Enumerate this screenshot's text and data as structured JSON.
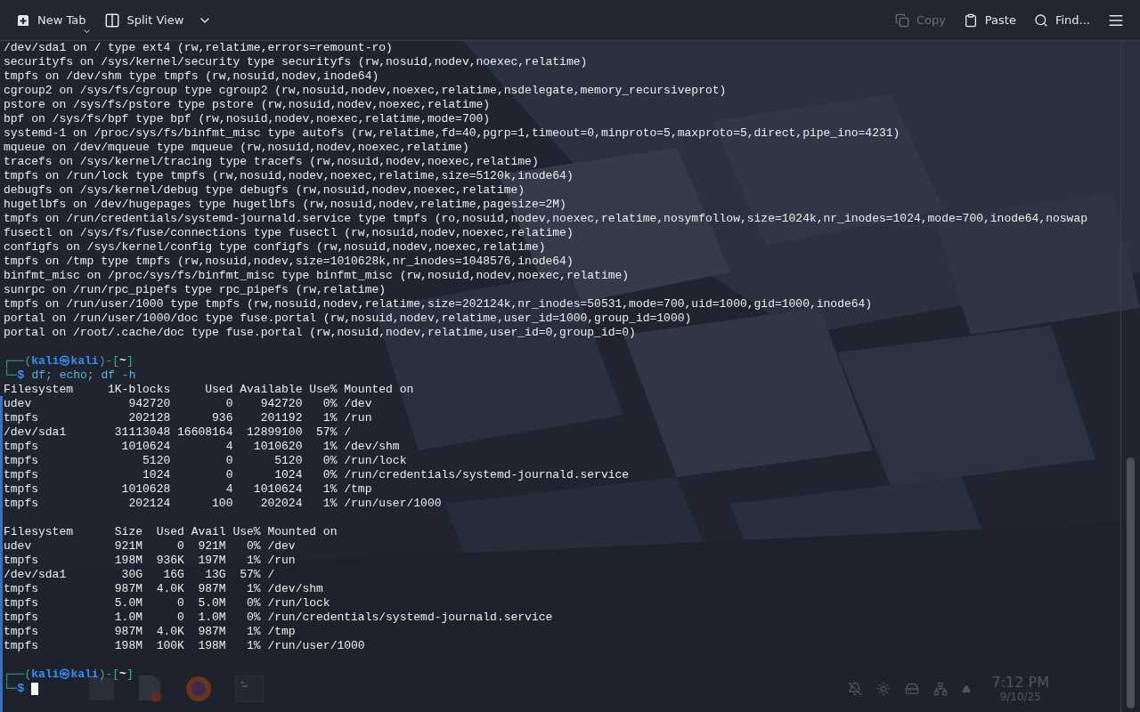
{
  "toolbar": {
    "left": [
      {
        "kind": "new_tab",
        "label": "New Tab",
        "disabled": false
      },
      {
        "kind": "split_view",
        "label": "Split View",
        "disabled": false
      }
    ],
    "right": [
      {
        "kind": "copy",
        "label": "Copy",
        "disabled": true
      },
      {
        "kind": "paste",
        "label": "Paste",
        "disabled": false
      },
      {
        "kind": "find",
        "label": "Find...",
        "disabled": false
      },
      {
        "kind": "menu",
        "disabled": false
      }
    ]
  },
  "terminal": {
    "lines": [
      {
        "kind": "output",
        "text": "/dev/sda1 on / type ext4 (rw,relatime,errors=remount-ro)"
      },
      {
        "kind": "output",
        "text": "securityfs on /sys/kernel/security type securityfs (rw,nosuid,nodev,noexec,relatime)"
      },
      {
        "kind": "output",
        "text": "tmpfs on /dev/shm type tmpfs (rw,nosuid,nodev,inode64)"
      },
      {
        "kind": "output",
        "text": "cgroup2 on /sys/fs/cgroup type cgroup2 (rw,nosuid,nodev,noexec,relatime,nsdelegate,memory_recursiveprot)"
      },
      {
        "kind": "output",
        "text": "pstore on /sys/fs/pstore type pstore (rw,nosuid,nodev,noexec,relatime)"
      },
      {
        "kind": "output",
        "text": "bpf on /sys/fs/bpf type bpf (rw,nosuid,nodev,noexec,relatime,mode=700)"
      },
      {
        "kind": "output",
        "text": "systemd-1 on /proc/sys/fs/binfmt_misc type autofs (rw,relatime,fd=40,pgrp=1,timeout=0,minproto=5,maxproto=5,direct,pipe_ino=4231)"
      },
      {
        "kind": "output",
        "text": "mqueue on /dev/mqueue type mqueue (rw,nosuid,nodev,noexec,relatime)"
      },
      {
        "kind": "output",
        "text": "tracefs on /sys/kernel/tracing type tracefs (rw,nosuid,nodev,noexec,relatime)"
      },
      {
        "kind": "output",
        "text": "tmpfs on /run/lock type tmpfs (rw,nosuid,nodev,noexec,relatime,size=5120k,inode64)"
      },
      {
        "kind": "output",
        "text": "debugfs on /sys/kernel/debug type debugfs (rw,nosuid,nodev,noexec,relatime)"
      },
      {
        "kind": "output",
        "text": "hugetlbfs on /dev/hugepages type hugetlbfs (rw,nosuid,nodev,relatime,pagesize=2M)"
      },
      {
        "kind": "output",
        "text": "tmpfs on /run/credentials/systemd-journald.service type tmpfs (ro,nosuid,nodev,noexec,relatime,nosymfollow,size=1024k,nr_inodes=1024,mode=700,inode64,noswap"
      },
      {
        "kind": "output",
        "text": "fusectl on /sys/fs/fuse/connections type fusectl (rw,nosuid,nodev,noexec,relatime)"
      },
      {
        "kind": "output",
        "text": "configfs on /sys/kernel/config type configfs (rw,nosuid,nodev,noexec,relatime)"
      },
      {
        "kind": "output",
        "text": "tmpfs on /tmp type tmpfs (rw,nosuid,nodev,size=1010628k,nr_inodes=1048576,inode64)"
      },
      {
        "kind": "output",
        "text": "binfmt_misc on /proc/sys/fs/binfmt_misc type binfmt_misc (rw,nosuid,nodev,noexec,relatime)"
      },
      {
        "kind": "output",
        "text": "sunrpc on /run/rpc_pipefs type rpc_pipefs (rw,relatime)"
      },
      {
        "kind": "output",
        "text": "tmpfs on /run/user/1000 type tmpfs (rw,nosuid,nodev,relatime,size=202124k,nr_inodes=50531,mode=700,uid=1000,gid=1000,inode64)"
      },
      {
        "kind": "output",
        "text": "portal on /run/user/1000/doc type fuse.portal (rw,nosuid,nodev,relatime,user_id=1000,group_id=1000)"
      },
      {
        "kind": "output",
        "text": "portal on /root/.cache/doc type fuse.portal (rw,nosuid,nodev,relatime,user_id=0,group_id=0)"
      },
      {
        "kind": "blank"
      },
      {
        "kind": "prompt",
        "open": "┌──(",
        "user": "kali",
        "at": "㉿",
        "host": "kali",
        "mid": ")-[",
        "dir": "~",
        "close": "]"
      },
      {
        "kind": "command",
        "corner": "└─",
        "sign": "$",
        "text": "df; echo; df -h",
        "cursor": false
      },
      {
        "kind": "output",
        "text": "Filesystem     1K-blocks     Used Available Use% Mounted on"
      },
      {
        "kind": "output",
        "text": "udev              942720        0    942720   0% /dev"
      },
      {
        "kind": "output",
        "text": "tmpfs             202128      936    201192   1% /run"
      },
      {
        "kind": "output",
        "text": "/dev/sda1       31113048 16608164  12899100  57% /"
      },
      {
        "kind": "output",
        "text": "tmpfs            1010624        4   1010620   1% /dev/shm"
      },
      {
        "kind": "output",
        "text": "tmpfs               5120        0      5120   0% /run/lock"
      },
      {
        "kind": "output",
        "text": "tmpfs               1024        0      1024   0% /run/credentials/systemd-journald.service"
      },
      {
        "kind": "output",
        "text": "tmpfs            1010628        4   1010624   1% /tmp"
      },
      {
        "kind": "output",
        "text": "tmpfs             202124      100    202024   1% /run/user/1000"
      },
      {
        "kind": "blank"
      },
      {
        "kind": "output",
        "text": "Filesystem      Size  Used Avail Use% Mounted on"
      },
      {
        "kind": "output",
        "text": "udev            921M     0  921M   0% /dev"
      },
      {
        "kind": "output",
        "text": "tmpfs           198M  936K  197M   1% /run"
      },
      {
        "kind": "output",
        "text": "/dev/sda1        30G   16G   13G  57% /"
      },
      {
        "kind": "output",
        "text": "tmpfs           987M  4.0K  987M   1% /dev/shm"
      },
      {
        "kind": "output",
        "text": "tmpfs           5.0M     0  5.0M   0% /run/lock"
      },
      {
        "kind": "output",
        "text": "tmpfs           1.0M     0  1.0M   0% /run/credentials/systemd-journald.service"
      },
      {
        "kind": "output",
        "text": "tmpfs           987M  4.0K  987M   1% /tmp"
      },
      {
        "kind": "output",
        "text": "tmpfs           198M  100K  198M   1% /run/user/1000"
      },
      {
        "kind": "blank"
      },
      {
        "kind": "prompt",
        "open": "┌──(",
        "user": "kali",
        "at": "㉿",
        "host": "kali",
        "mid": ")-[",
        "dir": "~",
        "close": "]"
      },
      {
        "kind": "command",
        "corner": "└─",
        "sign": "$",
        "cursor": true
      }
    ]
  },
  "taskbar": {
    "time": "7:12 PM",
    "date": "9/10/25"
  }
}
